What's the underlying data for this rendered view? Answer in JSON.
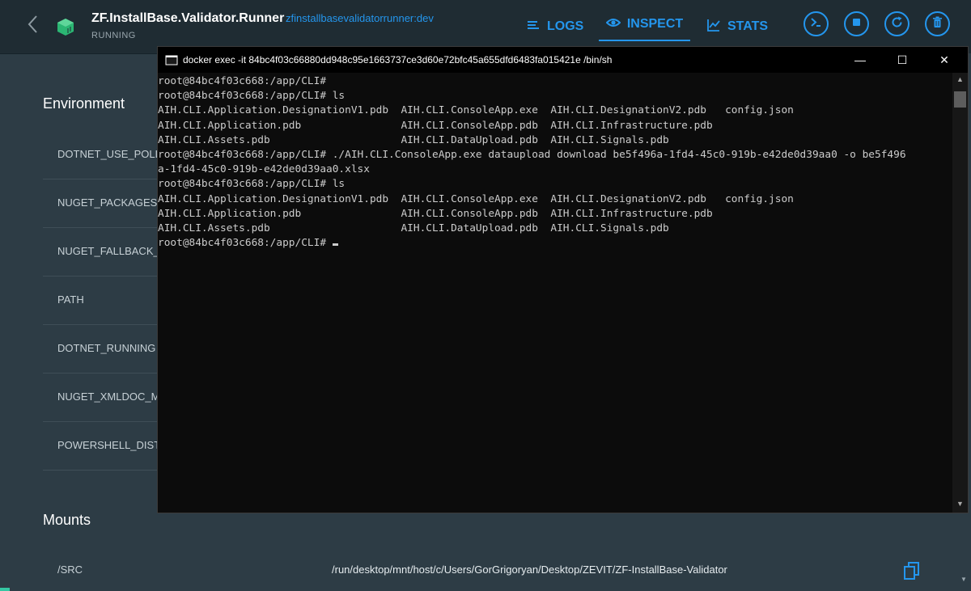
{
  "header": {
    "title": "ZF.InstallBase.Validator.Runner",
    "image": "zfinstallbasevalidatorrunner:dev",
    "status": "RUNNING",
    "tabs": [
      {
        "label": "LOGS",
        "icon": "logs-icon",
        "active": false
      },
      {
        "label": "INSPECT",
        "icon": "eye-icon",
        "active": true
      },
      {
        "label": "STATS",
        "icon": "stats-icon",
        "active": false
      }
    ],
    "actions": [
      "cli-icon",
      "stop-icon",
      "restart-icon",
      "delete-icon"
    ],
    "accent": "#2496ed"
  },
  "environment": {
    "title": "Environment",
    "rows": [
      "DOTNET_USE_POLL",
      "NUGET_PACKAGES",
      "NUGET_FALLBACK_",
      "PATH",
      "DOTNET_RUNNING",
      "NUGET_XMLDOC_M",
      "POWERSHELL_DISTI"
    ]
  },
  "mounts": {
    "title": "Mounts",
    "items": [
      {
        "key": "/SRC",
        "value": "/run/desktop/mnt/host/c/Users/GorGrigoryan/Desktop/ZEVIT/ZF-InstallBase-Validator"
      }
    ]
  },
  "terminal": {
    "title": "docker  exec -it 84bc4f03c66880dd948c95e1663737ce3d60e72bfc45a655dfd6483fa015421e /bin/sh",
    "lines": [
      "root@84bc4f03c668:/app/CLI#",
      "root@84bc4f03c668:/app/CLI# ls",
      "AIH.CLI.Application.DesignationV1.pdb  AIH.CLI.ConsoleApp.exe  AIH.CLI.DesignationV2.pdb   config.json",
      "AIH.CLI.Application.pdb                AIH.CLI.ConsoleApp.pdb  AIH.CLI.Infrastructure.pdb",
      "AIH.CLI.Assets.pdb                     AIH.CLI.DataUpload.pdb  AIH.CLI.Signals.pdb",
      "root@84bc4f03c668:/app/CLI# ./AIH.CLI.ConsoleApp.exe dataupload download be5f496a-1fd4-45c0-919b-e42de0d39aa0 -o be5f496",
      "a-1fd4-45c0-919b-e42de0d39aa0.xlsx",
      "root@84bc4f03c668:/app/CLI# ls",
      "AIH.CLI.Application.DesignationV1.pdb  AIH.CLI.ConsoleApp.exe  AIH.CLI.DesignationV2.pdb   config.json",
      "AIH.CLI.Application.pdb                AIH.CLI.ConsoleApp.pdb  AIH.CLI.Infrastructure.pdb",
      "AIH.CLI.Assets.pdb                     AIH.CLI.DataUpload.pdb  AIH.CLI.Signals.pdb",
      "root@84bc4f03c668:/app/CLI# "
    ],
    "window_buttons": {
      "minimize": "—",
      "maximize": "☐",
      "close": "✕"
    }
  }
}
